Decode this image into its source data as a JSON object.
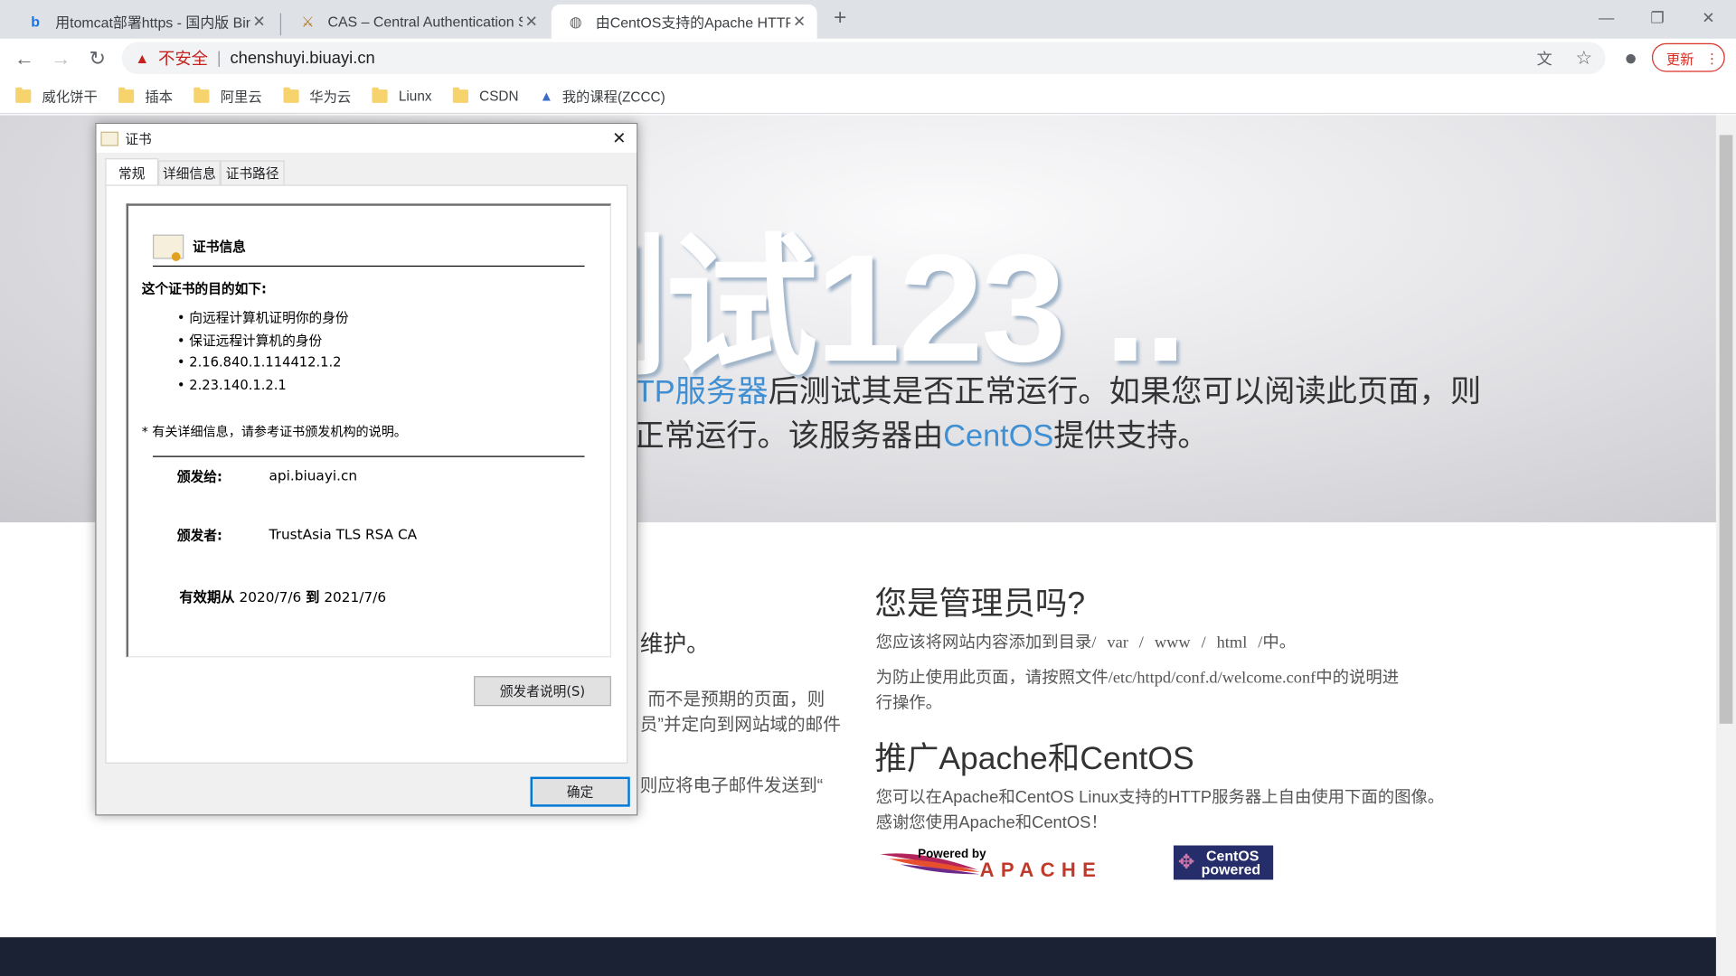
{
  "browser": {
    "tabs": [
      {
        "title": "用tomcat部署https - 国内版 Bing",
        "icon": "bing-icon",
        "active": false
      },
      {
        "title": "CAS – Central Authentication Service",
        "icon": "cas-icon",
        "active": false
      },
      {
        "title": "由CentOS支持的Apache HTTP Server",
        "icon": "globe-icon",
        "active": true
      }
    ],
    "new_tab_label": "+",
    "security_label": "不安全",
    "url": "chenshuyi.biuayi.cn",
    "update_label": "更新",
    "bookmarks": [
      {
        "label": "威化饼干",
        "icon": "folder-icon"
      },
      {
        "label": "插本",
        "icon": "folder-icon"
      },
      {
        "label": "阿里云",
        "icon": "folder-icon"
      },
      {
        "label": "华为云",
        "icon": "folder-icon"
      },
      {
        "label": "Liunx",
        "icon": "folder-icon"
      },
      {
        "label": "CSDN",
        "icon": "folder-icon"
      },
      {
        "label": "我的课程(ZCCC)",
        "icon": "course-icon"
      }
    ]
  },
  "page": {
    "hero_title": "测试123 ..",
    "hero_line1_link": "TP服务器",
    "hero_line1_rest": "后测试其是否正常运行。如果您可以阅读此页面，则",
    "hero_line2_a": "正常运行。该服务器由",
    "hero_line2_link": "CentOS",
    "hero_line2_b": "提供支持。",
    "left_col": [
      "维护。",
      "而不是预期的页面，则",
      "员”并定向到网站域的邮件",
      "则应将电子邮件发送到“"
    ],
    "admin_heading": "您是管理员吗?",
    "admin_p1_a": "您应该将网站内容添加到目录",
    "admin_p1_path": "/ var / www / html /",
    "admin_p1_b": "中。",
    "admin_p2_a": "为防止使用此页面，请按照文件",
    "admin_p2_path": "/etc/httpd/conf.d/welcome.conf",
    "admin_p2_b": "中的说明进",
    "admin_p2_c": "行操作。",
    "promo_heading": "推广Apache和CentOS",
    "promo_p1": "您可以在Apache和CentOS Linux支持的HTTP服务器上自由使用下面的图像。",
    "promo_p2": "感谢您使用Apache和CentOS！",
    "apache_logo_text": "Powered by APACHE",
    "centos_logo_text": "CentOS powered"
  },
  "dialog": {
    "title": "证书",
    "tabs": [
      "常规",
      "详细信息",
      "证书路径"
    ],
    "active_tab": "常规",
    "info_heading": "证书信息",
    "purpose_heading": "这个证书的目的如下:",
    "purposes": [
      "向远程计算机证明你的身份",
      "保证远程计算机的身份",
      "2.16.840.1.114412.1.2",
      "2.23.140.1.2.1"
    ],
    "note": "* 有关详细信息，请参考证书颁发机构的说明。",
    "issued_to_label": "颁发给:",
    "issued_to": "api.biuayi.cn",
    "issued_by_label": "颁发者:",
    "issued_by": "TrustAsia TLS RSA CA",
    "valid_from_label": "有效期从",
    "valid_from": "2020/7/6",
    "valid_to_label": "到",
    "valid_to": "2021/7/6",
    "issuer_statement_button": "颁发者说明(S)",
    "ok_button": "确定"
  }
}
